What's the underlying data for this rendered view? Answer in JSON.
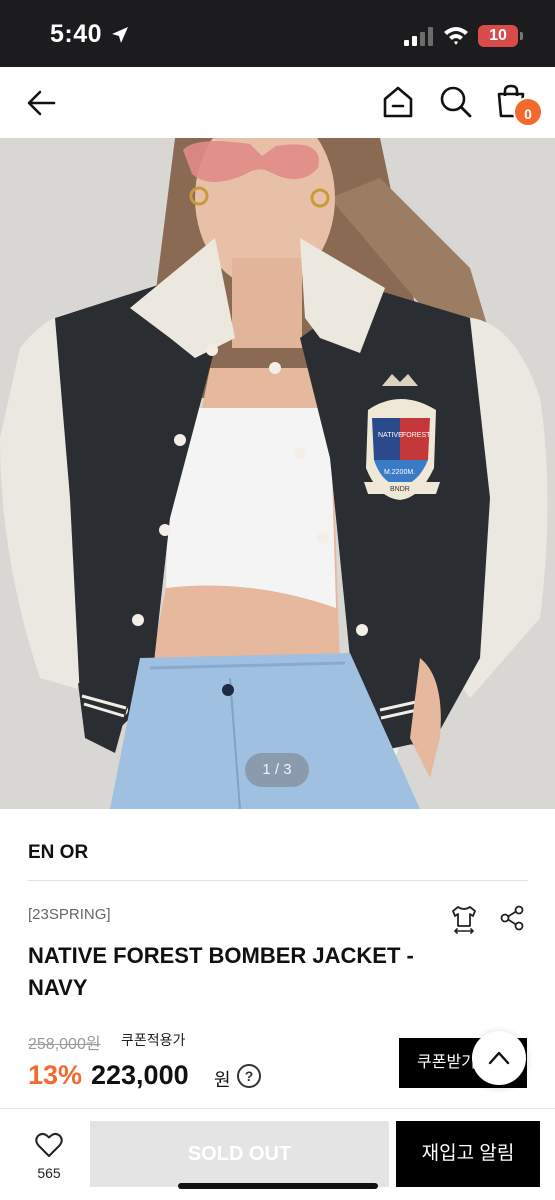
{
  "status_bar": {
    "time": "5:40",
    "battery": "10"
  },
  "nav": {
    "cart_count": "0"
  },
  "gallery": {
    "counter": "1 / 3"
  },
  "product": {
    "brand": "EN OR",
    "season": "[23SPRING]",
    "title": "NATIVE FOREST BOMBER JACKET - NAVY",
    "original_price": "258,000원",
    "coupon_label": "쿠폰적용가",
    "discount": "13%",
    "price": "223,000",
    "currency": "원",
    "patch_lines": [
      "NATIVE",
      "FOREST",
      "M.2200M.",
      "BNDR"
    ]
  },
  "buttons": {
    "coupon": "쿠폰받기",
    "sold_out": "SOLD OUT",
    "restock": "재입고 알림"
  },
  "likes": {
    "count": "565"
  },
  "colors": {
    "accent": "#f26a2e",
    "dark": "#000000",
    "sold_out_bg": "#e4e4e4"
  }
}
